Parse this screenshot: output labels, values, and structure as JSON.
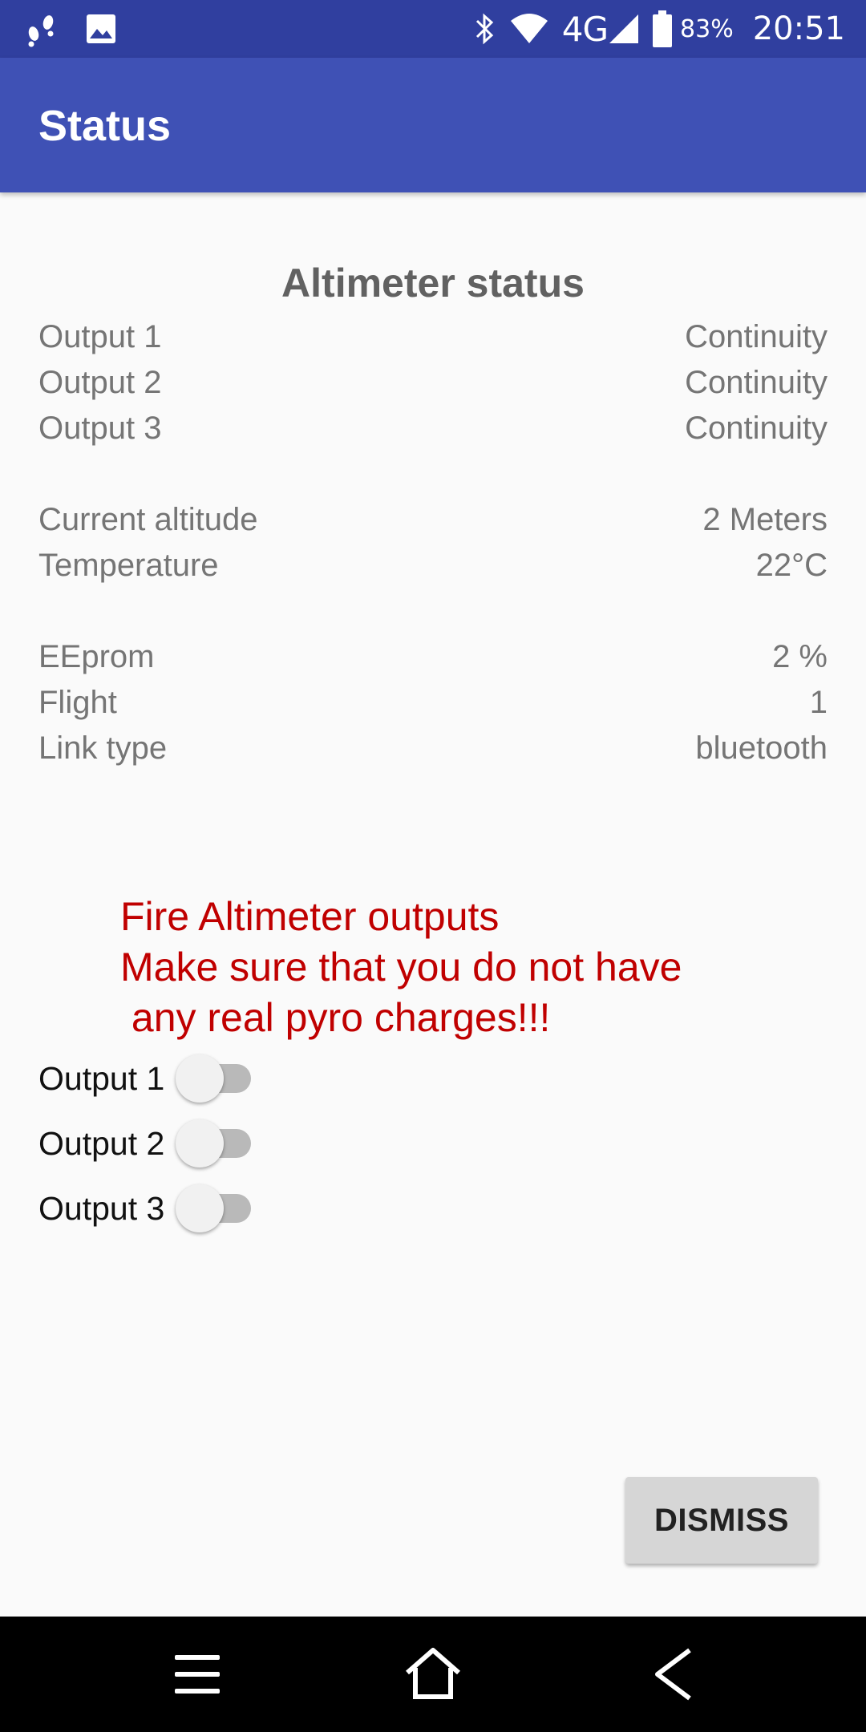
{
  "status_bar": {
    "network": "4G",
    "battery": "83%",
    "time": "20:51"
  },
  "appbar": {
    "title": "Status"
  },
  "altimeter": {
    "heading": "Altimeter status",
    "rows": [
      {
        "label": "Output 1",
        "value": "Continuity"
      },
      {
        "label": "Output 2",
        "value": "Continuity"
      },
      {
        "label": "Output 3",
        "value": "Continuity"
      },
      {
        "label": "Current altitude",
        "value": "2 Meters"
      },
      {
        "label": "Temperature",
        "value": "22°C"
      },
      {
        "label": "EEprom",
        "value": "2 %"
      },
      {
        "label": "Flight",
        "value": "1"
      },
      {
        "label": "Link type",
        "value": "bluetooth"
      }
    ]
  },
  "warning": {
    "line1": "Fire Altimeter outputs",
    "line2": "Make sure that you do not have",
    "line3": " any real pyro charges!!!"
  },
  "switches": [
    {
      "label": "Output 1",
      "checked": false
    },
    {
      "label": "Output 2",
      "checked": false
    },
    {
      "label": "Output 3",
      "checked": false
    }
  ],
  "dismiss_label": "DISMISS",
  "colors": {
    "primary": "#3f51b5",
    "primary_dark": "#303f9f",
    "warning": "#c00000"
  },
  "icons": [
    "footsteps-icon",
    "image-icon",
    "bluetooth-icon",
    "wifi-icon",
    "signal-icon",
    "battery-icon",
    "menu-icon",
    "home-icon",
    "back-icon"
  ]
}
